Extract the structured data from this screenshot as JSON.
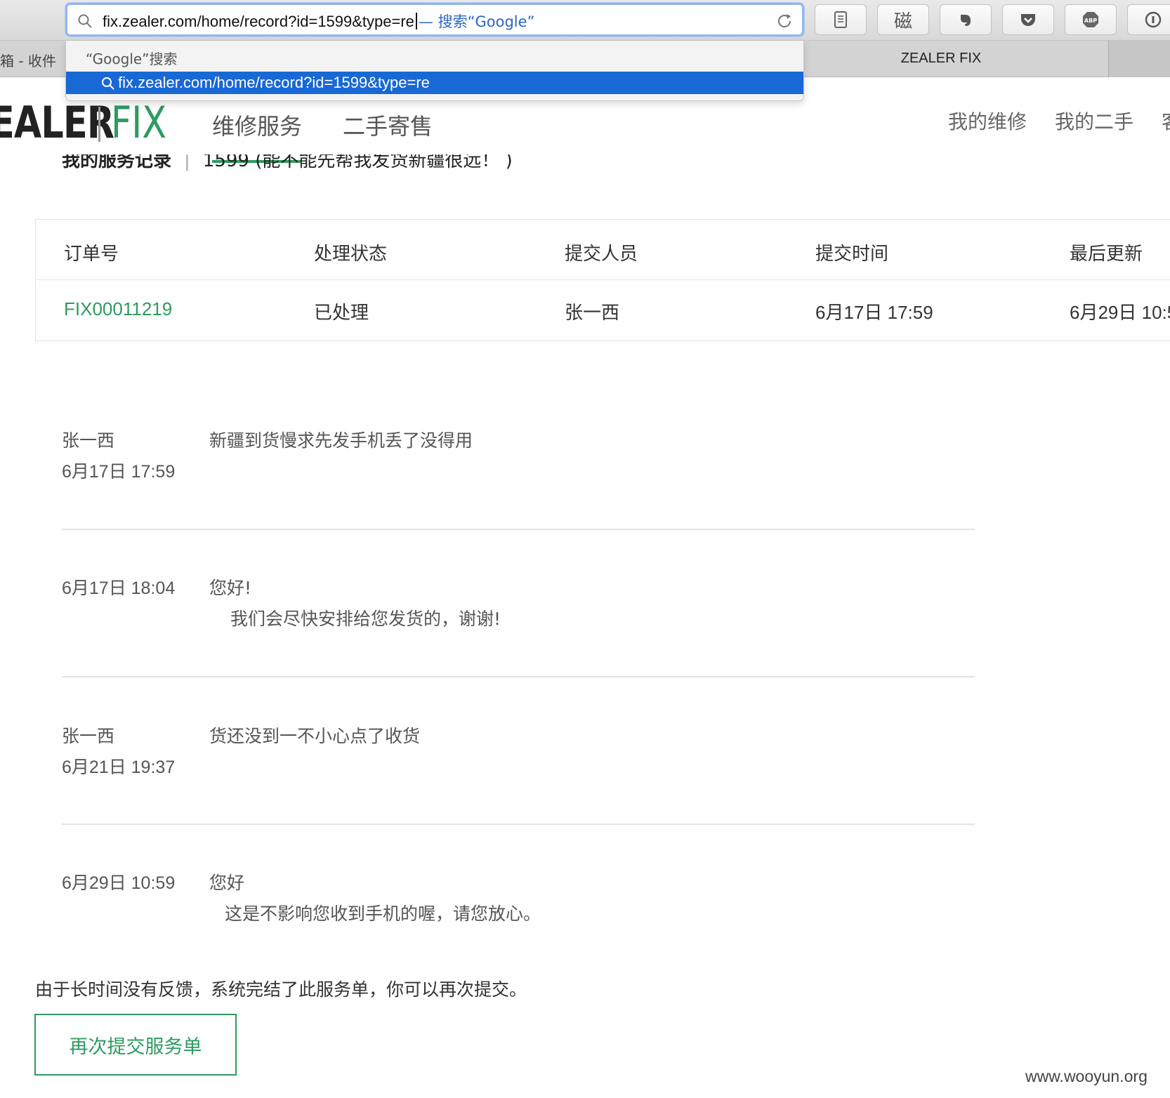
{
  "browser": {
    "url": "fix.zealer.com/home/record?id=1599&type=re",
    "search_hint": "— 搜索“Google”",
    "dropdown": {
      "header": "“Google”搜索",
      "item": "fix.zealer.com/home/record?id=1599&type=re"
    },
    "extensions": {
      "ime": "磁"
    },
    "tabs": {
      "left": "箱 - 收件",
      "active": "ZEALER FIX"
    }
  },
  "site": {
    "logo": {
      "zealer": "EALER",
      "fix": "FIX"
    },
    "nav": [
      "维修服务",
      "二手寄售"
    ],
    "nav_right": [
      "我的维修",
      "我的二手",
      "客"
    ]
  },
  "breadcrumb": {
    "section": "我的服务记录",
    "current": "1599 (能不能先帮我发货新疆很远！ )"
  },
  "table": {
    "headers": [
      "订单号",
      "处理状态",
      "提交人员",
      "提交时间",
      "最后更新"
    ],
    "row": {
      "order_id": "FIX00011219",
      "status": "已处理",
      "submitter": "张一西",
      "submit_time": "6月17日 17:59",
      "last_update": "6月29日 10:5"
    }
  },
  "records": [
    {
      "name": "张一西",
      "time": "6月17日 17:59",
      "msg": "新疆到货慢求先发手机丢了没得用",
      "msg2": ""
    },
    {
      "name": "",
      "time": "6月17日 18:04",
      "msg": "您好!",
      "msg2": "我们会尽快安排给您发货的，谢谢!"
    },
    {
      "name": "张一西",
      "time": "6月21日 19:37",
      "msg": "货还没到一不小心点了收货",
      "msg2": ""
    },
    {
      "name": "",
      "time": "6月29日 10:59",
      "msg": "您好",
      "msg2": "这是不影响您收到手机的喔，请您放心。"
    }
  ],
  "closing_note": "由于长时间没有反馈，系统完结了此服务单，你可以再次提交。",
  "resubmit_label": "再次提交服务单",
  "watermark": "www.wooyun.org",
  "colors": {
    "brand_green": "#2d9b5f",
    "selection_blue": "#1868d6"
  }
}
